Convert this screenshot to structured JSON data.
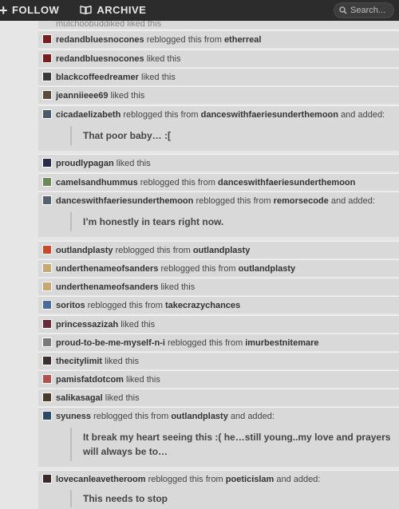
{
  "nav": {
    "follow_label": "FOLLOW",
    "archive_label": "ARCHIVE",
    "search_placeholder": "Search..."
  },
  "cut_row": "mulchoobuddiked liked this",
  "notes": [
    {
      "user": "redandbluesnocones",
      "action": "reblogged this from",
      "source": "etherreal",
      "added": "",
      "av": "#7a1f1f"
    },
    {
      "user": "redandbluesnocones",
      "action": "liked this",
      "source": "",
      "added": "",
      "av": "#7a1f1f"
    },
    {
      "user": "blackcoffeedreamer",
      "action": "liked this",
      "source": "",
      "added": "",
      "av": "#3a3a3a"
    },
    {
      "user": "jeanniieee69",
      "action": "liked this",
      "source": "",
      "added": "",
      "av": "#5a4a3a"
    },
    {
      "user": "cicadaelizabeth",
      "action": "reblogged this from",
      "source": "danceswithfaeriesunderthemoon",
      "tail": "and added:",
      "added": "That poor baby… :[",
      "av": "#4a5a6a"
    },
    {
      "user": "proudlypagan",
      "action": "liked this",
      "source": "",
      "added": "",
      "av": "#2a2a4a"
    },
    {
      "user": "camelsandhummus",
      "action": "reblogged this from",
      "source": "danceswithfaeriesunderthemoon",
      "added": "",
      "av": "#6a8a5a"
    },
    {
      "user": "danceswithfaeriesunderthemoon",
      "action": "reblogged this from",
      "source": "remorsecode",
      "tail": "and added:",
      "added": "I’m honestly in tears right now.",
      "av": "#556070"
    },
    {
      "user": "outlandplasty",
      "action": "reblogged this from",
      "source": "outlandplasty",
      "added": "",
      "av": "#c94a2a"
    },
    {
      "user": "underthenameofsanders",
      "action": "reblogged this from",
      "source": "outlandplasty",
      "added": "",
      "av": "#c8a870"
    },
    {
      "user": "underthenameofsanders",
      "action": "liked this",
      "source": "",
      "added": "",
      "av": "#c8a870"
    },
    {
      "user": "soritos",
      "action": "reblogged this from",
      "source": "takecrazychances",
      "added": "",
      "av": "#4a6aa0"
    },
    {
      "user": "princessazizah",
      "action": "liked this",
      "source": "",
      "added": "",
      "av": "#6a2a3a"
    },
    {
      "user": "proud-to-be-me-myself-n-i",
      "action": "reblogged this from",
      "source": "imurbestnitemare",
      "added": "",
      "av": "#7a7a7a"
    },
    {
      "user": "thecitylimit",
      "action": "liked this",
      "source": "",
      "added": "",
      "av": "#3a3030"
    },
    {
      "user": "pamisfatdotcom",
      "action": "liked this",
      "source": "",
      "added": "",
      "av": "#b05050"
    },
    {
      "user": "salikasagal",
      "action": "liked this",
      "source": "",
      "added": "",
      "av": "#4a3a2a"
    },
    {
      "user": "syuness",
      "action": "reblogged this from",
      "source": "outlandplasty",
      "tail": "and added:",
      "added": "It break my heart seeing this :( he…still young..my love and prayers will always be to…",
      "av": "#2a4a6a"
    },
    {
      "user": "lovecanleavetheroom",
      "action": "reblogged this from",
      "source": "poeticislam",
      "tail": "and added:",
      "added": "This needs to stop",
      "av": "#3a2a2a"
    }
  ]
}
